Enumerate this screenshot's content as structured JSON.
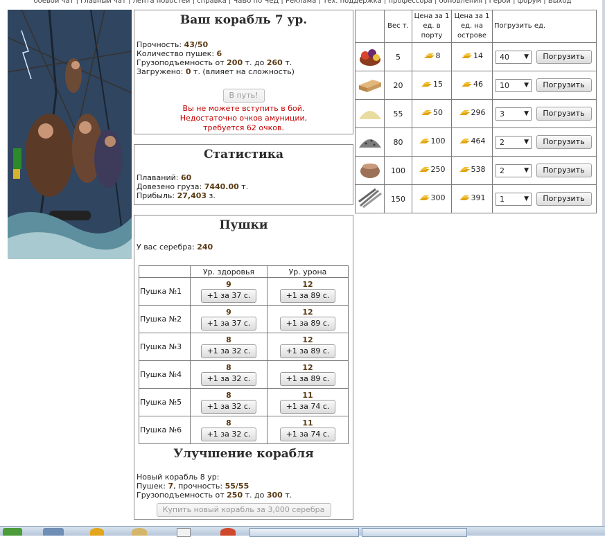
{
  "top_nav": "боевой чат | главный чат | лента новостей | справка | ЧаВо по ЧеД | Реклама | Тех. поддержка | профессора | обновления | Герой | форум | Выход",
  "ship": {
    "title": "Ваш корабль 7 ур.",
    "durability_label": "Прочность:",
    "durability_value": "43/50",
    "cannons_label": "Количество пушек:",
    "cannons_value": "6",
    "capacity_label": "Грузоподъемность от",
    "capacity_from": "200",
    "capacity_mid": "т. до",
    "capacity_to": "260",
    "capacity_unit": "т.",
    "loaded_label": "Загружено:",
    "loaded_value": "0",
    "loaded_note": "т. (влияет на сложность)",
    "go_button": "В путь!",
    "error_text": "Вы не можете вступить в бой. Недостаточно очков амуниции, требуется 62 очков."
  },
  "stats": {
    "title": "Статистика",
    "voyages_label": "Плаваний:",
    "voyages_value": "60",
    "cargo_label": "Довезено груза:",
    "cargo_value": "7440.00",
    "cargo_unit": "т.",
    "profit_label": "Прибыль:",
    "profit_value": "27,403",
    "profit_unit": "з."
  },
  "cannons": {
    "title": "Пушки",
    "silver_label": "У вас серебра:",
    "silver_value": "240",
    "col_health": "Ур. здоровья",
    "col_damage": "Ур. урона",
    "rows": [
      {
        "name": "Пушка №1",
        "health": "9",
        "health_btn": "+1 за 37 с.",
        "damage": "12",
        "damage_btn": "+1 за 89 с."
      },
      {
        "name": "Пушка №2",
        "health": "9",
        "health_btn": "+1 за 37 с.",
        "damage": "12",
        "damage_btn": "+1 за 89 с."
      },
      {
        "name": "Пушка №3",
        "health": "8",
        "health_btn": "+1 за 32 с.",
        "damage": "12",
        "damage_btn": "+1 за 89 с."
      },
      {
        "name": "Пушка №4",
        "health": "8",
        "health_btn": "+1 за 32 с.",
        "damage": "12",
        "damage_btn": "+1 за 89 с."
      },
      {
        "name": "Пушка №5",
        "health": "8",
        "health_btn": "+1 за 32 с.",
        "damage": "11",
        "damage_btn": "+1 за 74 с."
      },
      {
        "name": "Пушка №6",
        "health": "8",
        "health_btn": "+1 за 32 с.",
        "damage": "11",
        "damage_btn": "+1 за 74 с."
      }
    ]
  },
  "upgrade": {
    "title": "Улучшение корабля",
    "new_ship": "Новый корабль 8 ур:",
    "cannons_label": "Пушек:",
    "cannons_value": "7",
    "durability_label": ", прочность:",
    "durability_value": "55/55",
    "capacity_label": "Грузоподъемность от",
    "capacity_from": "250",
    "capacity_mid": "т. до",
    "capacity_to": "300",
    "capacity_unit": "т.",
    "buy_button": "Купить новый корабль за 3,000 серебра"
  },
  "goods": {
    "headers": {
      "weight": "Вес т.",
      "port_price": "Цена за 1 ед. в порту",
      "island_price": "Цена за 1 ед. на острове",
      "load": "Погрузить ед."
    },
    "rows": [
      {
        "icon": "fruit-basket-icon",
        "weight": "5",
        "port": "8",
        "island": "14",
        "qty": "40",
        "button": "Погрузить"
      },
      {
        "icon": "wood-planks-icon",
        "weight": "20",
        "port": "15",
        "island": "46",
        "qty": "10",
        "button": "Погрузить"
      },
      {
        "icon": "sand-pile-icon",
        "weight": "55",
        "port": "50",
        "island": "296",
        "qty": "3",
        "button": "Погрузить"
      },
      {
        "icon": "ore-pile-icon",
        "weight": "80",
        "port": "100",
        "island": "464",
        "qty": "2",
        "button": "Погрузить"
      },
      {
        "icon": "sack-icon",
        "weight": "100",
        "port": "250",
        "island": "538",
        "qty": "2",
        "button": "Погрузить"
      },
      {
        "icon": "iron-bars-icon",
        "weight": "150",
        "port": "300",
        "island": "391",
        "qty": "1",
        "button": "Погрузить"
      }
    ]
  },
  "colors": {
    "bold_value": "#5a3a14",
    "error": "#c40000",
    "gold": "#e0a310"
  }
}
